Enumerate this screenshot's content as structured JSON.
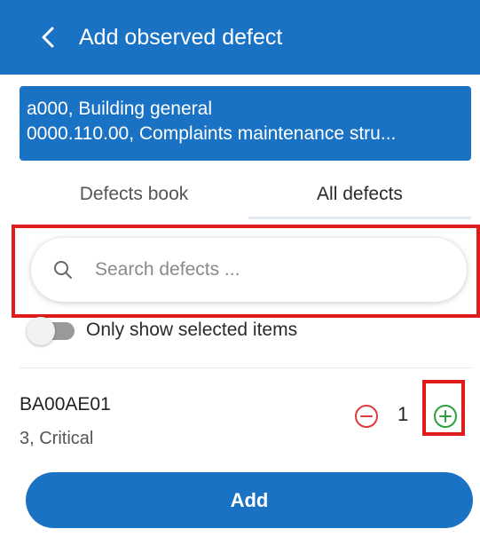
{
  "header": {
    "back_icon": "chevron-left-icon",
    "title": "Add observed defect"
  },
  "context": {
    "line1": "a000, Building general",
    "line2": "0000.110.00, Complaints maintenance stru..."
  },
  "tabs": [
    {
      "label": "Defects book",
      "active": false
    },
    {
      "label": "All defects",
      "active": true
    }
  ],
  "search": {
    "icon": "search-icon",
    "placeholder": "Search defects ...",
    "value": ""
  },
  "filter": {
    "toggle_label": "Only show selected items",
    "enabled": false
  },
  "defects": [
    {
      "code": "BA00AE01",
      "severity": "3, Critical",
      "quantity": "1",
      "minus_icon": "minus-circle-icon",
      "plus_icon": "plus-circle-icon"
    }
  ],
  "footer": {
    "add_label": "Add"
  },
  "colors": {
    "brand": "#1a72c4",
    "minus": "#e03b3b",
    "plus": "#2e9e3e",
    "highlight": "#e01b1b"
  }
}
